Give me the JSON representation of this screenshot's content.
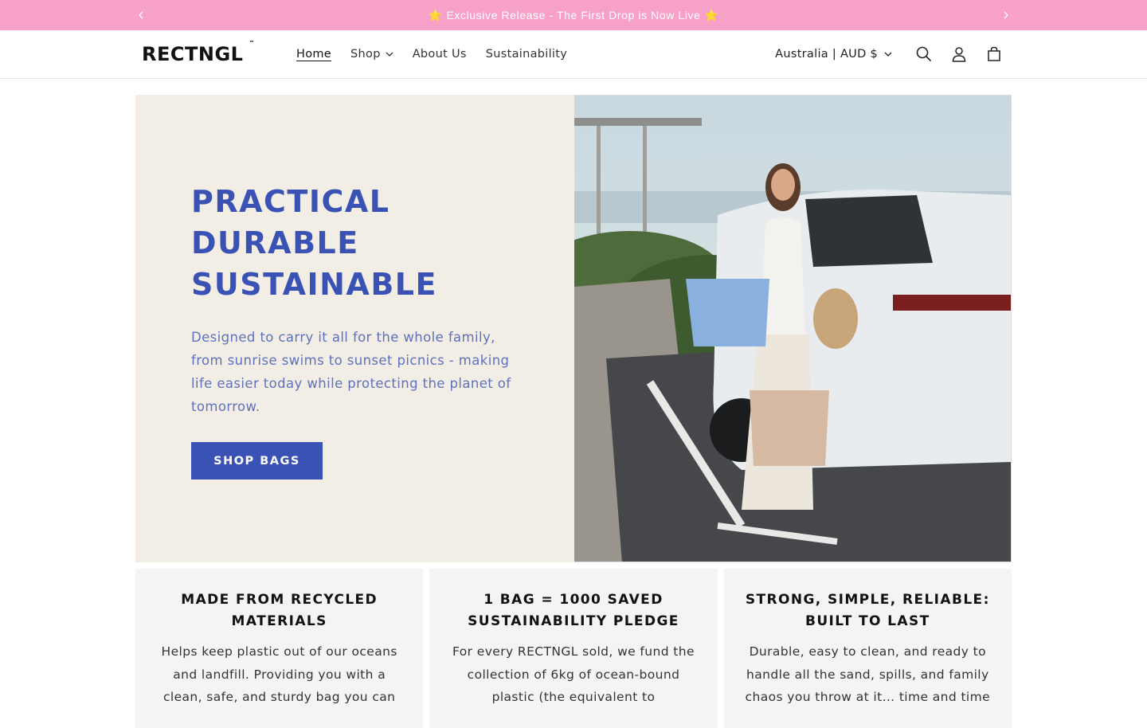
{
  "announcement": {
    "message": "⭐ Exclusive Release - The First Drop is Now Live ⭐",
    "prev_icon": "chevron-left-icon",
    "next_icon": "chevron-right-icon"
  },
  "header": {
    "logo": "RECTNGL",
    "logo_tm": "™",
    "nav": [
      {
        "label": "Home",
        "active": true
      },
      {
        "label": "Shop",
        "dropdown": true
      },
      {
        "label": "About Us"
      },
      {
        "label": "Sustainability"
      }
    ],
    "locale": "Australia | AUD $",
    "icons": [
      "search-icon",
      "account-icon",
      "cart-icon"
    ]
  },
  "hero": {
    "title_lines": [
      "PRACTICAL",
      "DURABLE",
      "SUSTAINABLE"
    ],
    "subtitle": "Designed to carry it all for the whole family, from sunrise swims to sunset picnics - making life easier today while protecting the planet of tomorrow.",
    "button_label": "SHOP BAGS",
    "colors": {
      "accent": "#3a52b4",
      "panel_bg": "#f2eee6"
    }
  },
  "features": [
    {
      "title": "MADE FROM RECYCLED MATERIALS",
      "text": "Helps keep plastic out of our oceans and landfill. Providing you with a clean, safe, and sturdy bag you can"
    },
    {
      "title": "1 BAG = 1000 SAVED SUSTAINABILITY PLEDGE",
      "text": "For every RECTNGL sold, we fund the collection of 6kg of ocean-bound plastic (the equivalent to"
    },
    {
      "title": "STRONG, SIMPLE, RELIABLE: BUILT TO LAST",
      "text": "Durable, easy to clean, and ready to handle all the sand, spills, and family chaos you throw at it… time and time"
    }
  ],
  "colors": {
    "announce_bg": "#f7a1c9"
  }
}
